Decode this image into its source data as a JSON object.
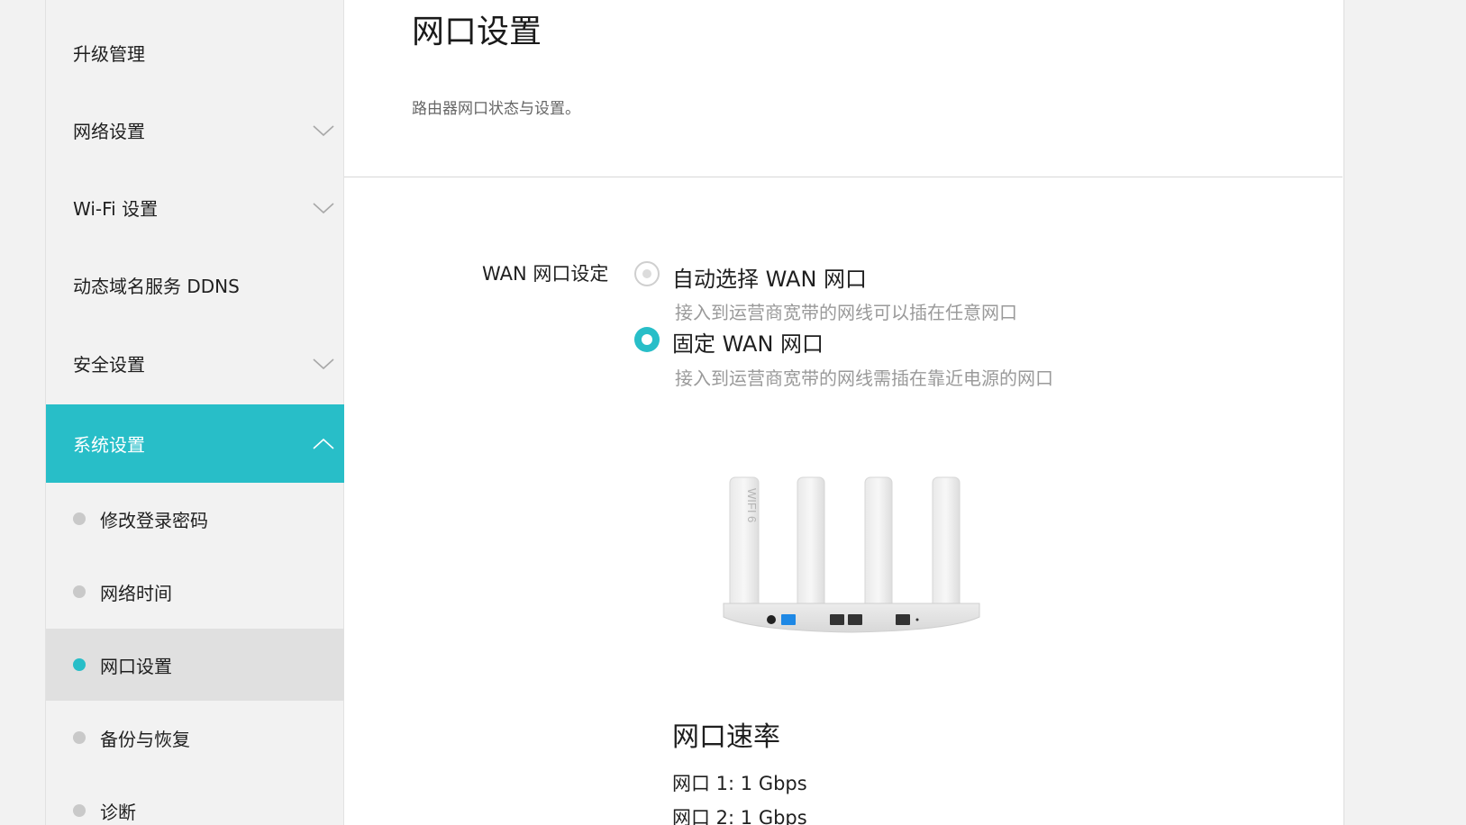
{
  "sidebar": {
    "items": [
      {
        "label": "升级管理"
      },
      {
        "label": "网络设置"
      },
      {
        "label": "Wi-Fi 设置"
      },
      {
        "label": "动态域名服务 DDNS"
      },
      {
        "label": "安全设置"
      },
      {
        "label": "系统设置"
      }
    ],
    "sub_items": [
      {
        "label": "修改登录密码"
      },
      {
        "label": "网络时间"
      },
      {
        "label": "网口设置"
      },
      {
        "label": "备份与恢复"
      },
      {
        "label": "诊断"
      }
    ]
  },
  "main": {
    "title": "网口设置",
    "description": "路由器网口状态与设置。",
    "wan_setting": {
      "label": "WAN 网口设定",
      "options": [
        {
          "label": "自动选择 WAN 网口",
          "hint": "接入到运营商宽带的网线可以插在任意网口",
          "selected": false
        },
        {
          "label": "固定 WAN 网口",
          "hint": "接入到运营商宽带的网线需插在靠近电源的网口",
          "selected": true
        }
      ]
    },
    "router_image": {
      "antenna_text": "WIFI 6"
    },
    "speed": {
      "title": "网口速率",
      "rows": [
        {
          "label": "网口 1:  1 Gbps"
        },
        {
          "label": "网口 2:  1 Gbps"
        }
      ]
    }
  },
  "colors": {
    "accent": "#28bec8",
    "selected_bg": "#e0e0e0",
    "sidebar_bg": "#f2f2f2"
  },
  "icons": [
    "chevron-down-icon",
    "chevron-up-icon",
    "radio-icon"
  ]
}
